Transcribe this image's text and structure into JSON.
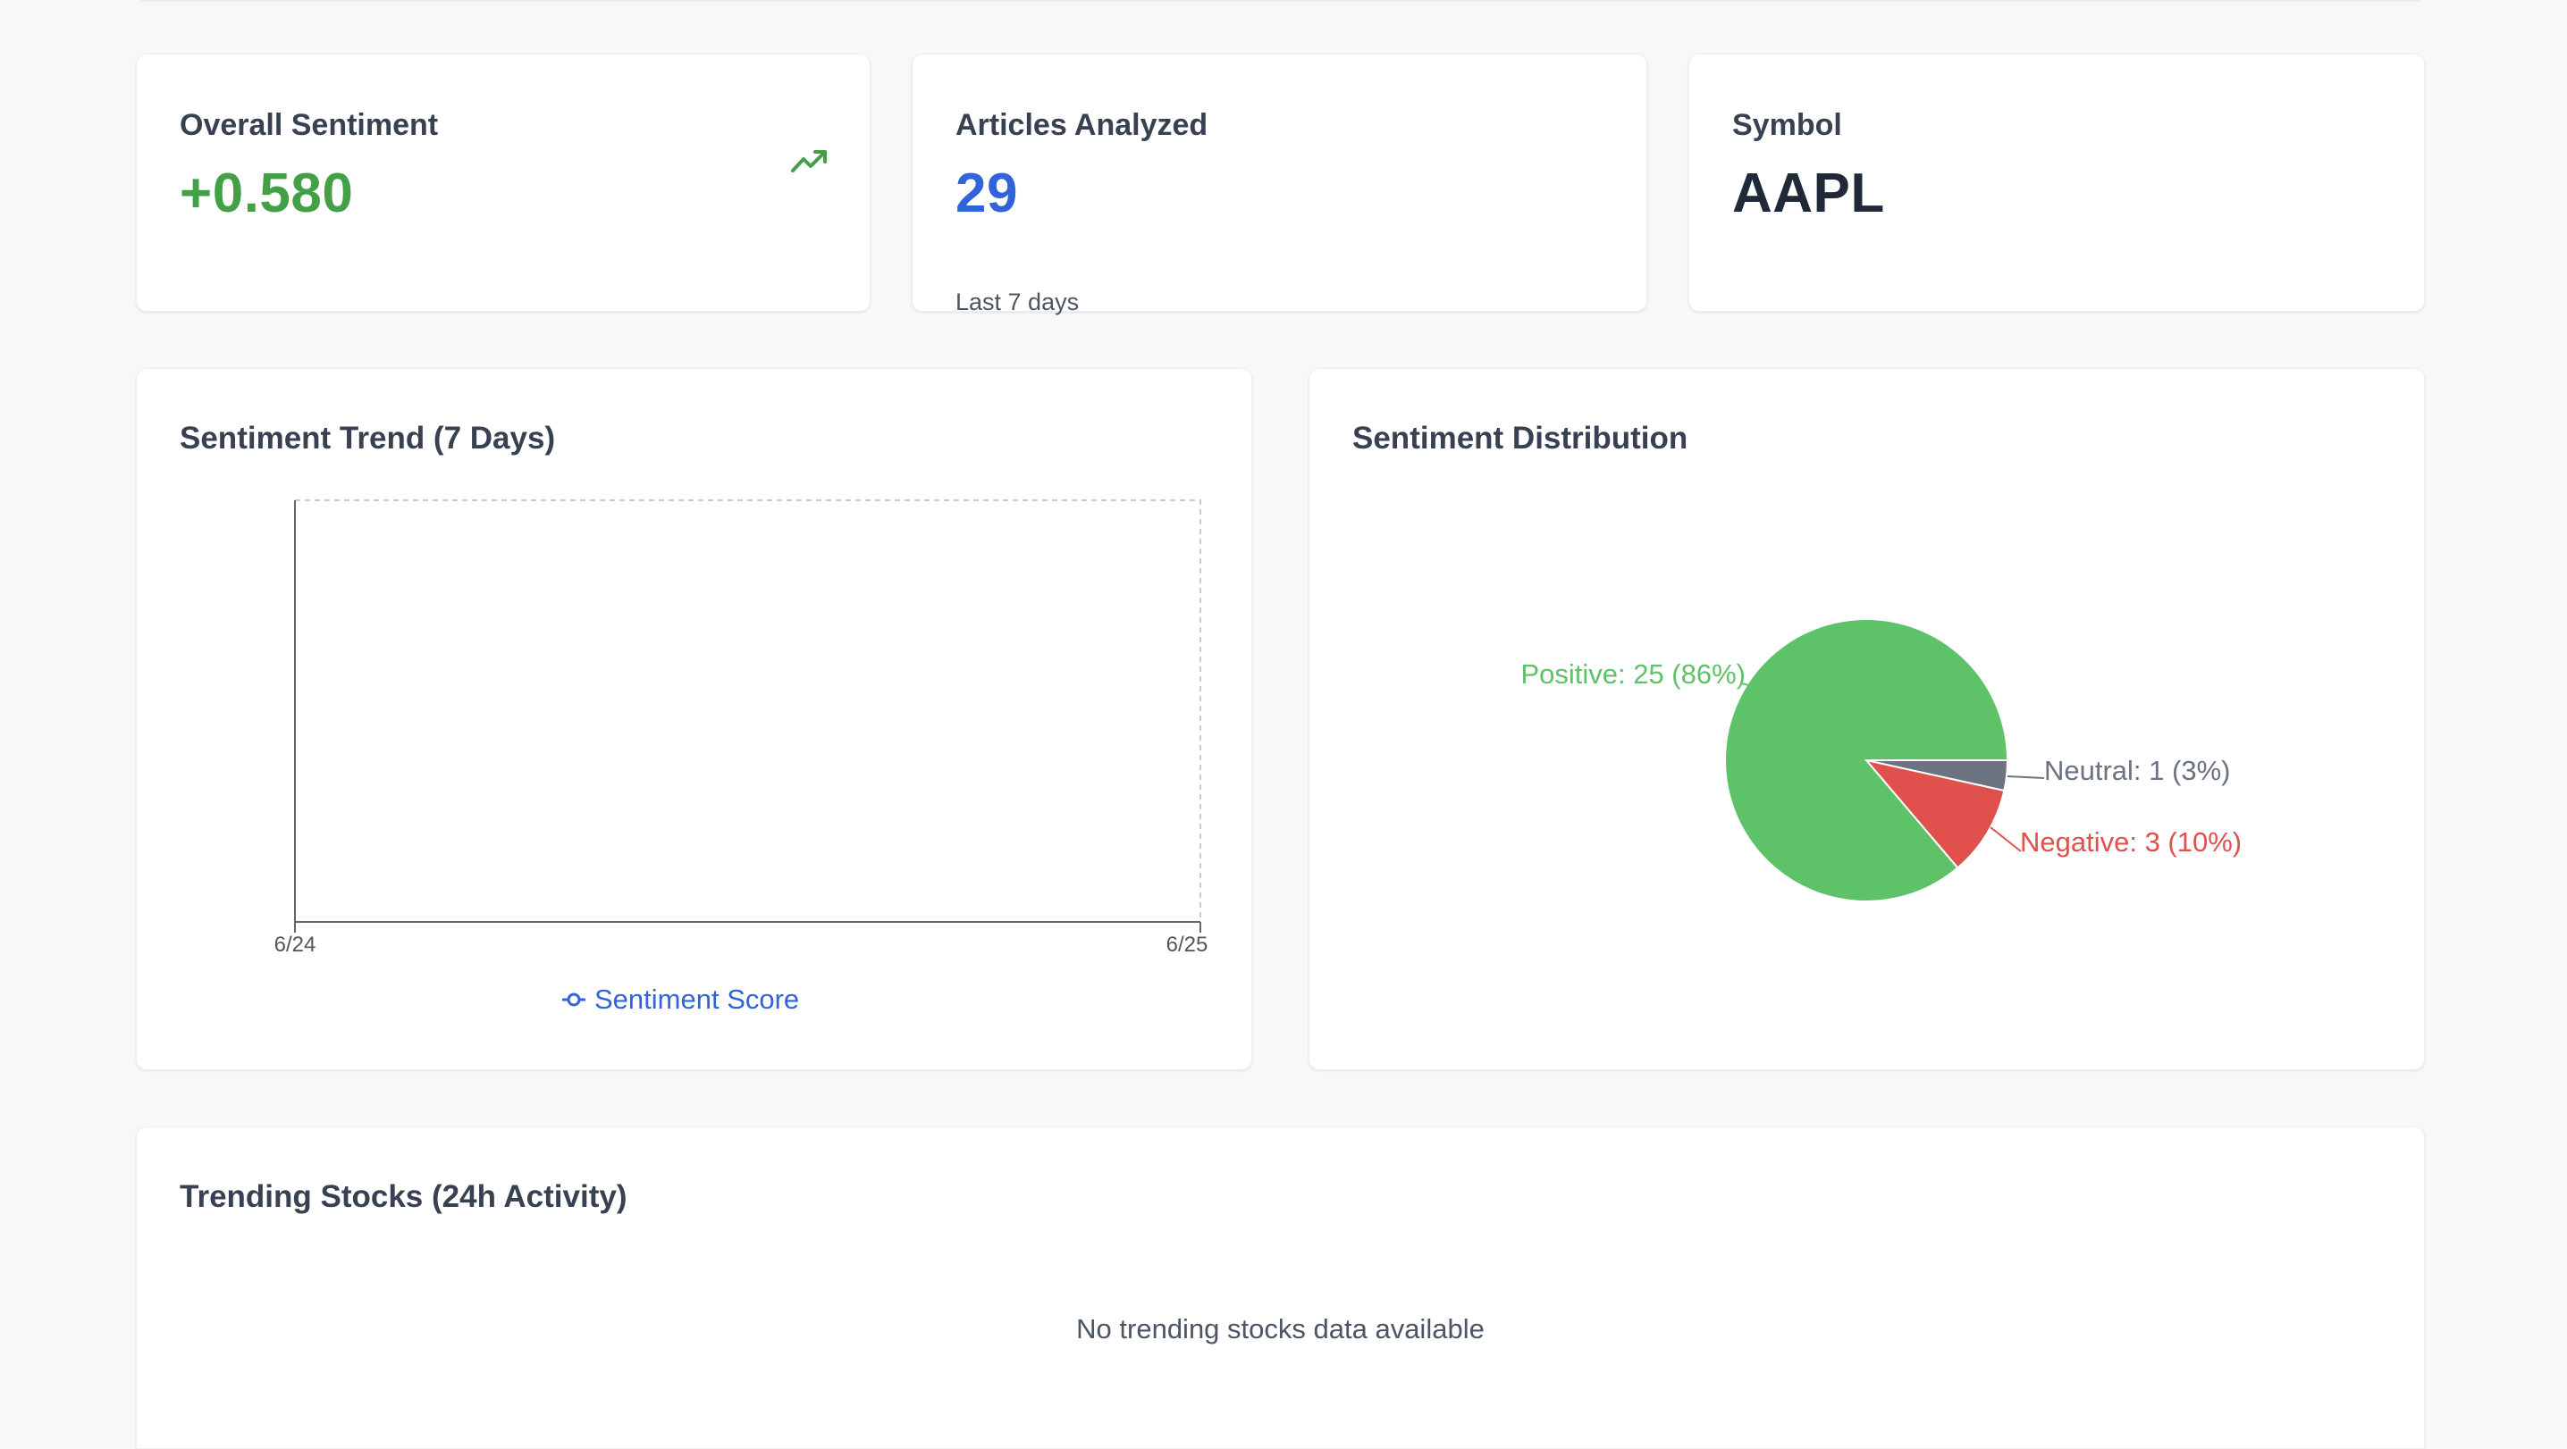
{
  "stats": {
    "sentiment": {
      "label": "Overall Sentiment",
      "value": "+0.580",
      "icon": "trending-up-icon",
      "color": "#43a047"
    },
    "articles": {
      "label": "Articles Analyzed",
      "value": "29",
      "sub": "Last 7 days",
      "color": "#3164d8"
    },
    "symbol": {
      "label": "Symbol",
      "value": "AAPL",
      "color": "#1f2937"
    }
  },
  "trend": {
    "title": "Sentiment Trend (7 Days)",
    "legend": "Sentiment Score",
    "color": "#3164d8"
  },
  "distribution": {
    "title": "Sentiment Distribution"
  },
  "trending": {
    "title": "Trending Stocks (24h Activity)",
    "empty": "No trending stocks data available"
  },
  "chart_data": [
    {
      "type": "line",
      "title": "Sentiment Trend (7 Days)",
      "x": [
        "6/24",
        "6/25"
      ],
      "series": [
        {
          "name": "Sentiment Score",
          "values": []
        }
      ],
      "legend": "bottom"
    },
    {
      "type": "pie",
      "title": "Sentiment Distribution",
      "slices": [
        {
          "label": "Positive",
          "value": 25,
          "percent": 86,
          "text": "Positive: 25 (86%)",
          "color": "#5ec268"
        },
        {
          "label": "Neutral",
          "value": 1,
          "percent": 3,
          "text": "Neutral: 1 (3%)",
          "color": "#6b7280"
        },
        {
          "label": "Negative",
          "value": 3,
          "percent": 10,
          "text": "Negative: 3 (10%)",
          "color": "#e0504d"
        }
      ]
    }
  ]
}
